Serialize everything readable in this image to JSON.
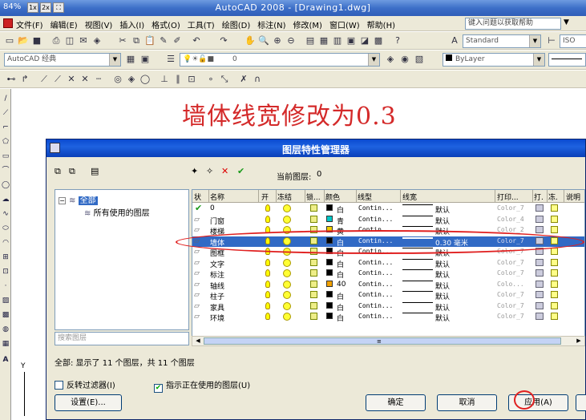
{
  "window": {
    "zoom": "84%",
    "zoom_1x": "1x",
    "zoom_2x": "2x",
    "title": "AutoCAD 2008 - [Drawing1.dwg]"
  },
  "menu": {
    "items": [
      "文件(F)",
      "编辑(E)",
      "视图(V)",
      "插入(I)",
      "格式(O)",
      "工具(T)",
      "绘图(D)",
      "标注(N)",
      "修改(M)",
      "窗口(W)",
      "帮助(H)"
    ],
    "help_placeholder": "键入问题以获取帮助"
  },
  "toolbar": {
    "text_style": "Standard",
    "dim_style": "ISO",
    "workspace": "AutoCAD 经典",
    "layer_combo": "0",
    "color_combo": "ByLayer"
  },
  "annotation": "墙体线宽修改为0.3",
  "dialog": {
    "title": "图层特性管理器",
    "current_layer_label": "当前图层:",
    "current_layer_value": "0",
    "tree_root": "全部",
    "tree_child": "所有使用的图层",
    "search_placeholder": "搜索图层",
    "columns": [
      "状",
      "名称",
      "开",
      "冻结",
      "锁...",
      "颜色",
      "线型",
      "线宽",
      "打印...",
      "打.",
      "冻.",
      "说明"
    ],
    "rows": [
      {
        "name": "0",
        "color_name": "白",
        "color": "#000000",
        "linetype": "Contin...",
        "lineweight": "默认",
        "plot_style": "Color_7",
        "current": true
      },
      {
        "name": "门窗",
        "color_name": "青",
        "color": "#00c8c8",
        "linetype": "Contin...",
        "lineweight": "默认",
        "plot_style": "Color_4"
      },
      {
        "name": "楼梯",
        "color_name": "黄",
        "color": "#f0d000",
        "linetype": "Contin...",
        "lineweight": "默认",
        "plot_style": "Color_2"
      },
      {
        "name": "墙体",
        "color_name": "白",
        "color": "#000000",
        "linetype": "Contin...",
        "lineweight": "0.30 毫米",
        "plot_style": "Color_7",
        "selected": true
      },
      {
        "name": "图框",
        "color_name": "白",
        "color": "#000000",
        "linetype": "Contin...",
        "lineweight": "默认",
        "plot_style": "Color_7"
      },
      {
        "name": "文字",
        "color_name": "白",
        "color": "#000000",
        "linetype": "Contin...",
        "lineweight": "默认",
        "plot_style": "Color_7"
      },
      {
        "name": "标注",
        "color_name": "白",
        "color": "#000000",
        "linetype": "Contin...",
        "lineweight": "默认",
        "plot_style": "Color_7"
      },
      {
        "name": "轴线",
        "color_name": "40",
        "color": "#f0a000",
        "linetype": "Contin...",
        "lineweight": "默认",
        "plot_style": "Colo..."
      },
      {
        "name": "柱子",
        "color_name": "白",
        "color": "#000000",
        "linetype": "Contin...",
        "lineweight": "默认",
        "plot_style": "Color_7"
      },
      {
        "name": "家具",
        "color_name": "白",
        "color": "#000000",
        "linetype": "Contin...",
        "lineweight": "默认",
        "plot_style": "Color_7"
      },
      {
        "name": "环境",
        "color_name": "白",
        "color": "#000000",
        "linetype": "Contin...",
        "lineweight": "默认",
        "plot_style": "Color_7"
      }
    ],
    "status_text": "全部: 显示了 11 个图层，共 11 个图层",
    "invert_filter_label": "反转过滤器(I)",
    "show_used_label": "指示正在使用的图层(U)",
    "settings_button": "设置(E)...",
    "ok_button": "确定",
    "cancel_button": "取消",
    "apply_button": "应用(A)"
  },
  "colors": {
    "annotation": "#d42a2a",
    "highlight": "#e02020",
    "selection": "#316ac5"
  }
}
